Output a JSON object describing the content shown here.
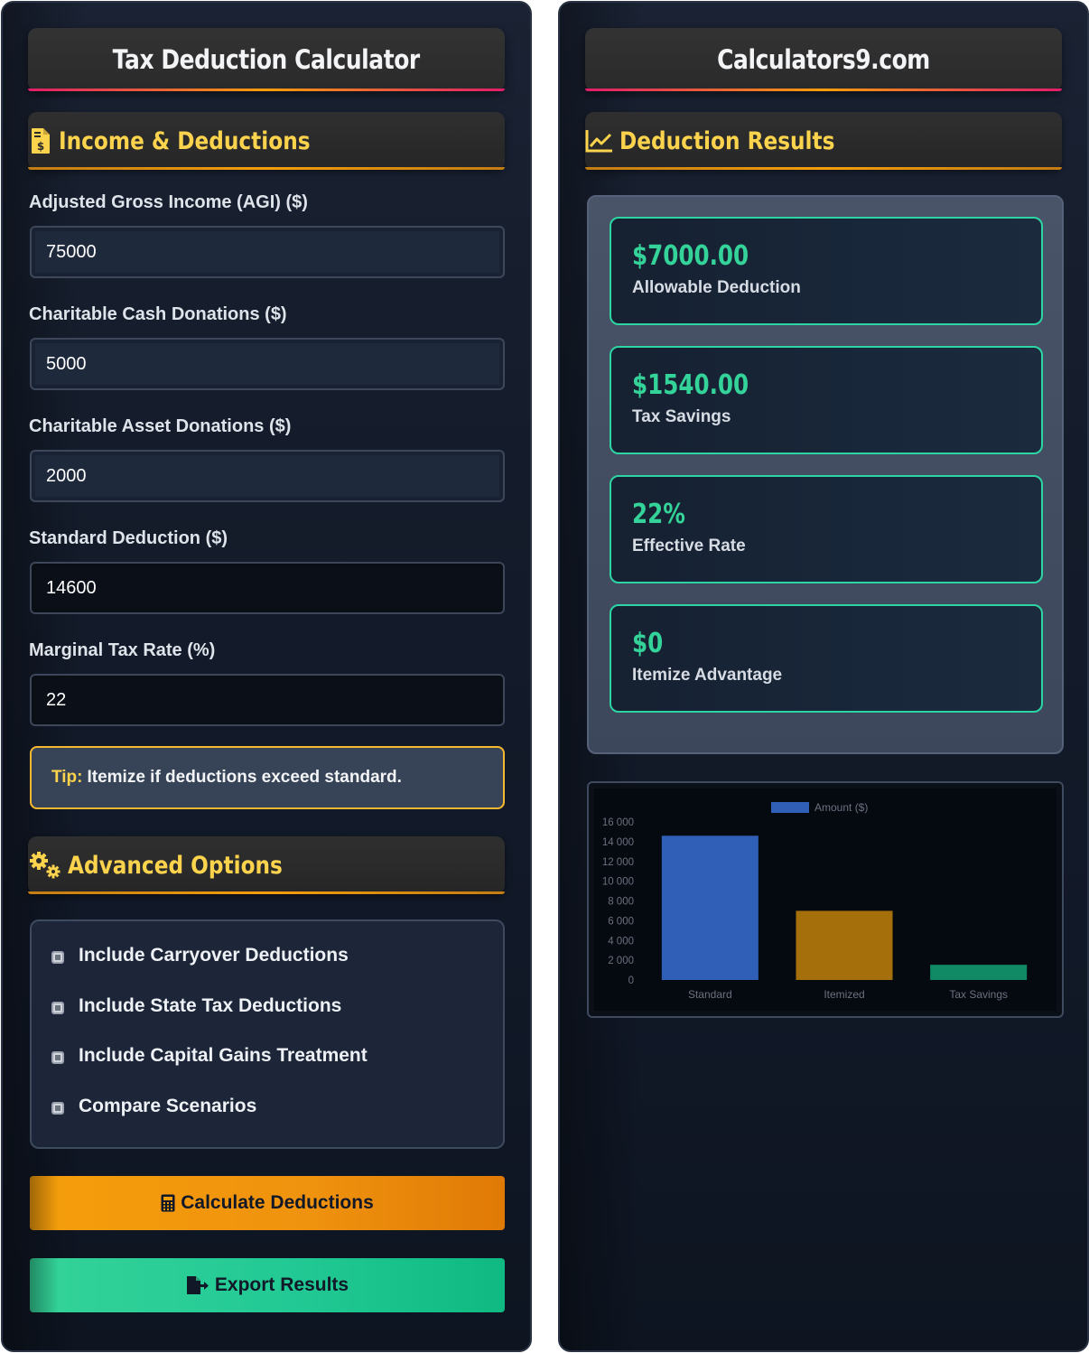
{
  "left": {
    "title": "Tax Deduction Calculator",
    "income_section": {
      "title": "Income & Deductions",
      "icon": "file-invoice-dollar-icon"
    },
    "fields": [
      {
        "label": "Adjusted Gross Income (AGI) ($)",
        "value": "75000"
      },
      {
        "label": "Charitable Cash Donations ($)",
        "value": "5000"
      },
      {
        "label": "Charitable Asset Donations ($)",
        "value": "2000"
      },
      {
        "label": "Standard Deduction ($)",
        "value": "14600"
      },
      {
        "label": "Marginal Tax Rate (%)",
        "value": "22"
      }
    ],
    "tip": {
      "label": "Tip:",
      "text": "Itemize if deductions exceed standard."
    },
    "advanced_section": {
      "title": "Advanced Options",
      "icon": "cogs-icon"
    },
    "options": [
      {
        "label": "Include Carryover Deductions",
        "checked": false
      },
      {
        "label": "Include State Tax Deductions",
        "checked": false
      },
      {
        "label": "Include Capital Gains Treatment",
        "checked": false
      },
      {
        "label": "Compare Scenarios",
        "checked": false
      }
    ],
    "calculate_label": "Calculate Deductions",
    "export_label": "Export Results"
  },
  "right": {
    "title": "Calculators9.com",
    "results_section": {
      "title": "Deduction Results",
      "icon": "chart-line-icon"
    },
    "results": [
      {
        "value": "$7000.00",
        "label": "Allowable Deduction"
      },
      {
        "value": "$1540.00",
        "label": "Tax Savings"
      },
      {
        "value": "22%",
        "label": "Effective Rate"
      },
      {
        "value": "$0",
        "label": "Itemize Advantage"
      }
    ]
  },
  "colors": {
    "accent_yellow": "#fcd34d",
    "accent_green": "#34d399",
    "button_orange": "#f59e0b",
    "button_green": "#10b981"
  },
  "chart_data": {
    "type": "bar",
    "categories": [
      "Standard",
      "Itemized",
      "Tax Savings"
    ],
    "series": [
      {
        "name": "Amount ($)",
        "values": [
          14600,
          7000,
          1540
        ]
      }
    ],
    "bar_colors": [
      "#2f5fb6",
      "#a5700b",
      "#108a64"
    ],
    "ylim": [
      0,
      16000
    ],
    "yticks": [
      "0",
      "2 000",
      "4 000",
      "6 000",
      "8 000",
      "10 000",
      "12 000",
      "14 000",
      "16 000"
    ],
    "ytick_values": [
      0,
      2000,
      4000,
      6000,
      8000,
      10000,
      12000,
      14000,
      16000
    ],
    "legend_position": "top-center",
    "grid": false
  }
}
